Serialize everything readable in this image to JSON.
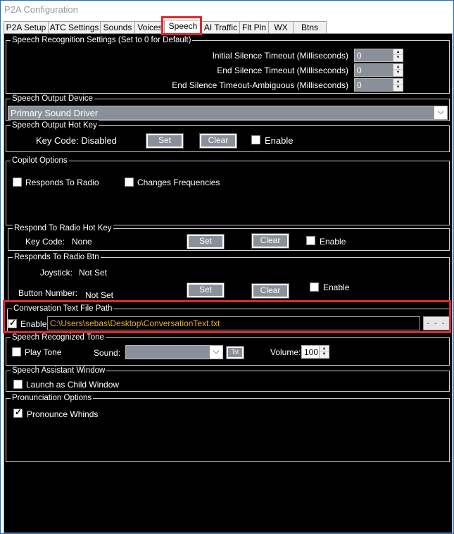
{
  "window": {
    "title": "P2A Configuration"
  },
  "tabs": [
    {
      "label": "P2A Setup"
    },
    {
      "label": "ATC Settings"
    },
    {
      "label": "Sounds"
    },
    {
      "label": "Voices"
    },
    {
      "label": "Speech"
    },
    {
      "label": "AI Traffic"
    },
    {
      "label": "Flt Pln"
    },
    {
      "label": "WX"
    },
    {
      "label": "Btns"
    }
  ],
  "active_tab": "Speech",
  "recognition": {
    "legend": "Speech Recognition Settings (Set to 0 for Default)",
    "initial_label": "Initial Silence Timeout (Milliseconds)",
    "initial_value": "0",
    "end_label": "End Silence Timeout (Milliseconds)",
    "end_value": "0",
    "ambiguous_label": "End Silence Timeout-Ambiguous (Milliseconds)",
    "ambiguous_value": "0"
  },
  "output_device": {
    "legend": "Speech Output Device",
    "selected": "Primary Sound Driver"
  },
  "output_hotkey": {
    "legend": "Speech Output Hot Key",
    "keycode_label": "Key Code: Disabled",
    "set_label": "Set",
    "clear_label": "Clear",
    "enable_label": "Enable",
    "enable_checked": false
  },
  "copilot": {
    "legend": "Copilot Options",
    "responds_label": "Responds To Radio",
    "responds_checked": false,
    "frequencies_label": "Changes Frequencies",
    "frequencies_checked": false
  },
  "radio_hotkey": {
    "legend": "Respond To Radio Hot Key",
    "keycode_label": "Key Code:",
    "keycode_value": "None",
    "set_label": "Set",
    "clear_label": "Clear",
    "enable_label": "Enable",
    "enable_checked": false
  },
  "radio_btn": {
    "legend": "Responds To Radio Btn",
    "joystick_label": "Joystick:",
    "joystick_value": "Not Set",
    "button_label": "Button Number:",
    "button_value": "Not Set",
    "set_label": "Set",
    "clear_label": "Clear",
    "enable_label": "Enable",
    "enable_checked": false
  },
  "conversation": {
    "legend": "Conversation Text File Path",
    "enable_label": "Enable",
    "enable_checked": true,
    "path": "C:\\Users\\sebas\\Desktop\\ConversationText.txt",
    "browse_label": "- - -"
  },
  "tone": {
    "legend": "Speech Recognized Tone",
    "play_label": "Play Tone",
    "play_checked": false,
    "sound_label": "Sound:",
    "sound_value": "",
    "test_label": "Tst",
    "volume_label": "Volume:",
    "volume_value": "100"
  },
  "assistant": {
    "legend": "Speech Assistant Window",
    "child_label": "Launch as Child Window",
    "child_checked": false
  },
  "pronunciation": {
    "legend": "Pronunciation Options",
    "whinds_label": "Pronounce Whinds",
    "whinds_checked": true
  },
  "colors": {
    "panel_bg": "#000000",
    "highlight": "#e1262d",
    "path_text": "#e8b020",
    "control_grey": "#8a9099"
  }
}
